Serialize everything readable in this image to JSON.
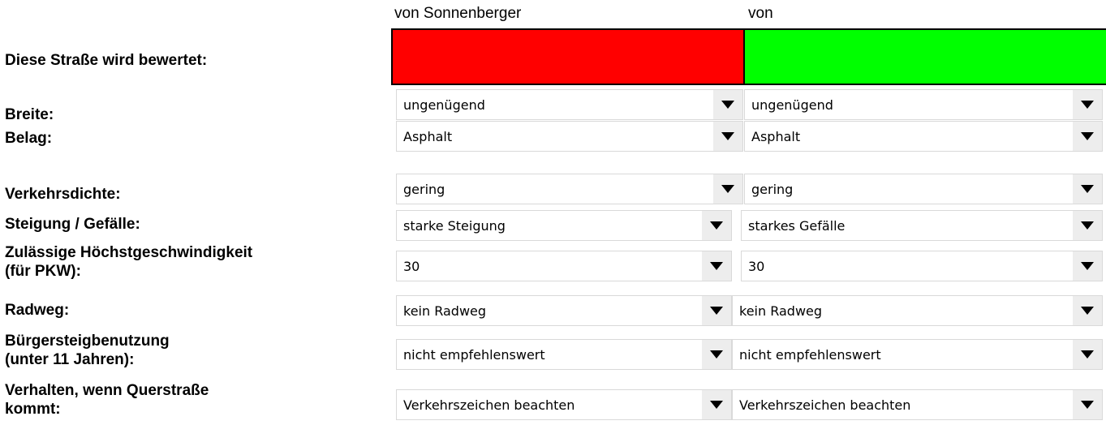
{
  "columns": {
    "left_header": "von Sonnenberger",
    "right_header": "von"
  },
  "colors": {
    "left_swatch": "#ff0000",
    "right_swatch": "#00ff00"
  },
  "rows": [
    {
      "label": "Diese Straße wird bewertet:"
    },
    {
      "label": "Breite:",
      "left": "ungenügend",
      "right": "ungenügend"
    },
    {
      "label": "Belag:",
      "left": "Asphalt",
      "right": "Asphalt"
    },
    {
      "label": "Verkehrsdichte:",
      "left": "gering",
      "right": "gering"
    },
    {
      "label": "Steigung / Gefälle:",
      "left": "starke Steigung",
      "right": "starkes Gefälle"
    },
    {
      "label_line1": "Zulässige Höchstgeschwindigkeit",
      "label_line2": "(für PKW):",
      "left": "30",
      "right": "30"
    },
    {
      "label": "Radweg:",
      "left": "kein Radweg",
      "right": "kein Radweg"
    },
    {
      "label_line1": "Bürgersteigbenutzung",
      "label_line2": "(unter 11 Jahren):",
      "left": "nicht empfehlenswert",
      "right": "nicht empfehlenswert"
    },
    {
      "label_line1": "Verhalten, wenn Querstraße",
      "label_line2": "kommt:",
      "left": "Verkehrszeichen beachten",
      "right": "Verkehrszeichen beachten"
    }
  ],
  "icons": {
    "dropdown": "caret-down-icon"
  }
}
